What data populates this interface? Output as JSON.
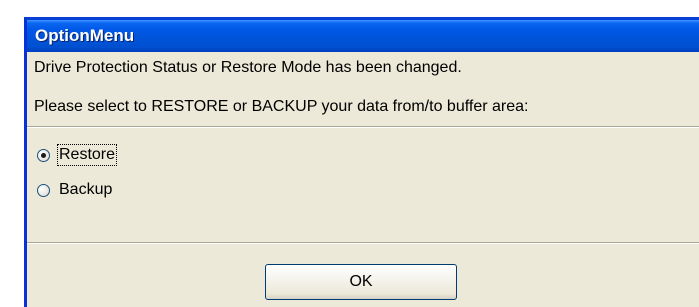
{
  "window": {
    "title": "OptionMenu"
  },
  "message": {
    "line1": "Drive Protection Status or Restore Mode has been changed.",
    "line2": "Please select to RESTORE or BACKUP your data from/to buffer area:"
  },
  "options": [
    {
      "label": "Restore",
      "selected": true
    },
    {
      "label": "Backup",
      "selected": false
    }
  ],
  "buttons": {
    "ok_label": "OK"
  },
  "colors": {
    "titlebar": "#0054e3",
    "dialog_face": "#ece9d8",
    "title_text": "#ffffff"
  }
}
